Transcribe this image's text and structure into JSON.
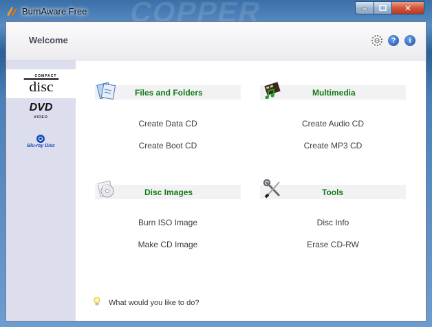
{
  "window": {
    "title": "BurnAware Free",
    "min_glyph": "",
    "max_glyph": "",
    "close_glyph": "✕"
  },
  "header": {
    "title": "Welcome",
    "settings_glyph": "⚙",
    "help_glyph": "?",
    "info_glyph": "i"
  },
  "sidebar": {
    "items": [
      {
        "name": "compact-disc",
        "icon": "cd-logo-icon",
        "label": "disc",
        "small": "COMPACT"
      },
      {
        "name": "dvd",
        "icon": "dvd-logo-icon",
        "label": "DVD",
        "small": "VIDEO"
      },
      {
        "name": "blu-ray",
        "icon": "bluray-logo-icon",
        "label": "Blu-ray Disc"
      }
    ]
  },
  "sections": {
    "files": {
      "title": "Files and Folders",
      "icon": "documents-icon",
      "links": [
        "Create Data CD",
        "Create Boot CD"
      ]
    },
    "multimedia": {
      "title": "Multimedia",
      "icon": "film-music-icon",
      "links": [
        "Create Audio CD",
        "Create MP3 CD"
      ]
    },
    "images": {
      "title": "Disc Images",
      "icon": "disc-image-icon",
      "links": [
        "Burn ISO Image",
        "Make CD Image"
      ]
    },
    "tools": {
      "title": "Tools",
      "icon": "wrench-screwdriver-icon",
      "links": [
        "Disc Info",
        "Erase CD-RW"
      ]
    }
  },
  "footer": {
    "tip": "What would you like to do?",
    "icon": "lightbulb-icon"
  },
  "colors": {
    "section_title": "#137a13",
    "sidebar_bg": "#dcdeee",
    "accent_blue": "#1c4fa8"
  }
}
